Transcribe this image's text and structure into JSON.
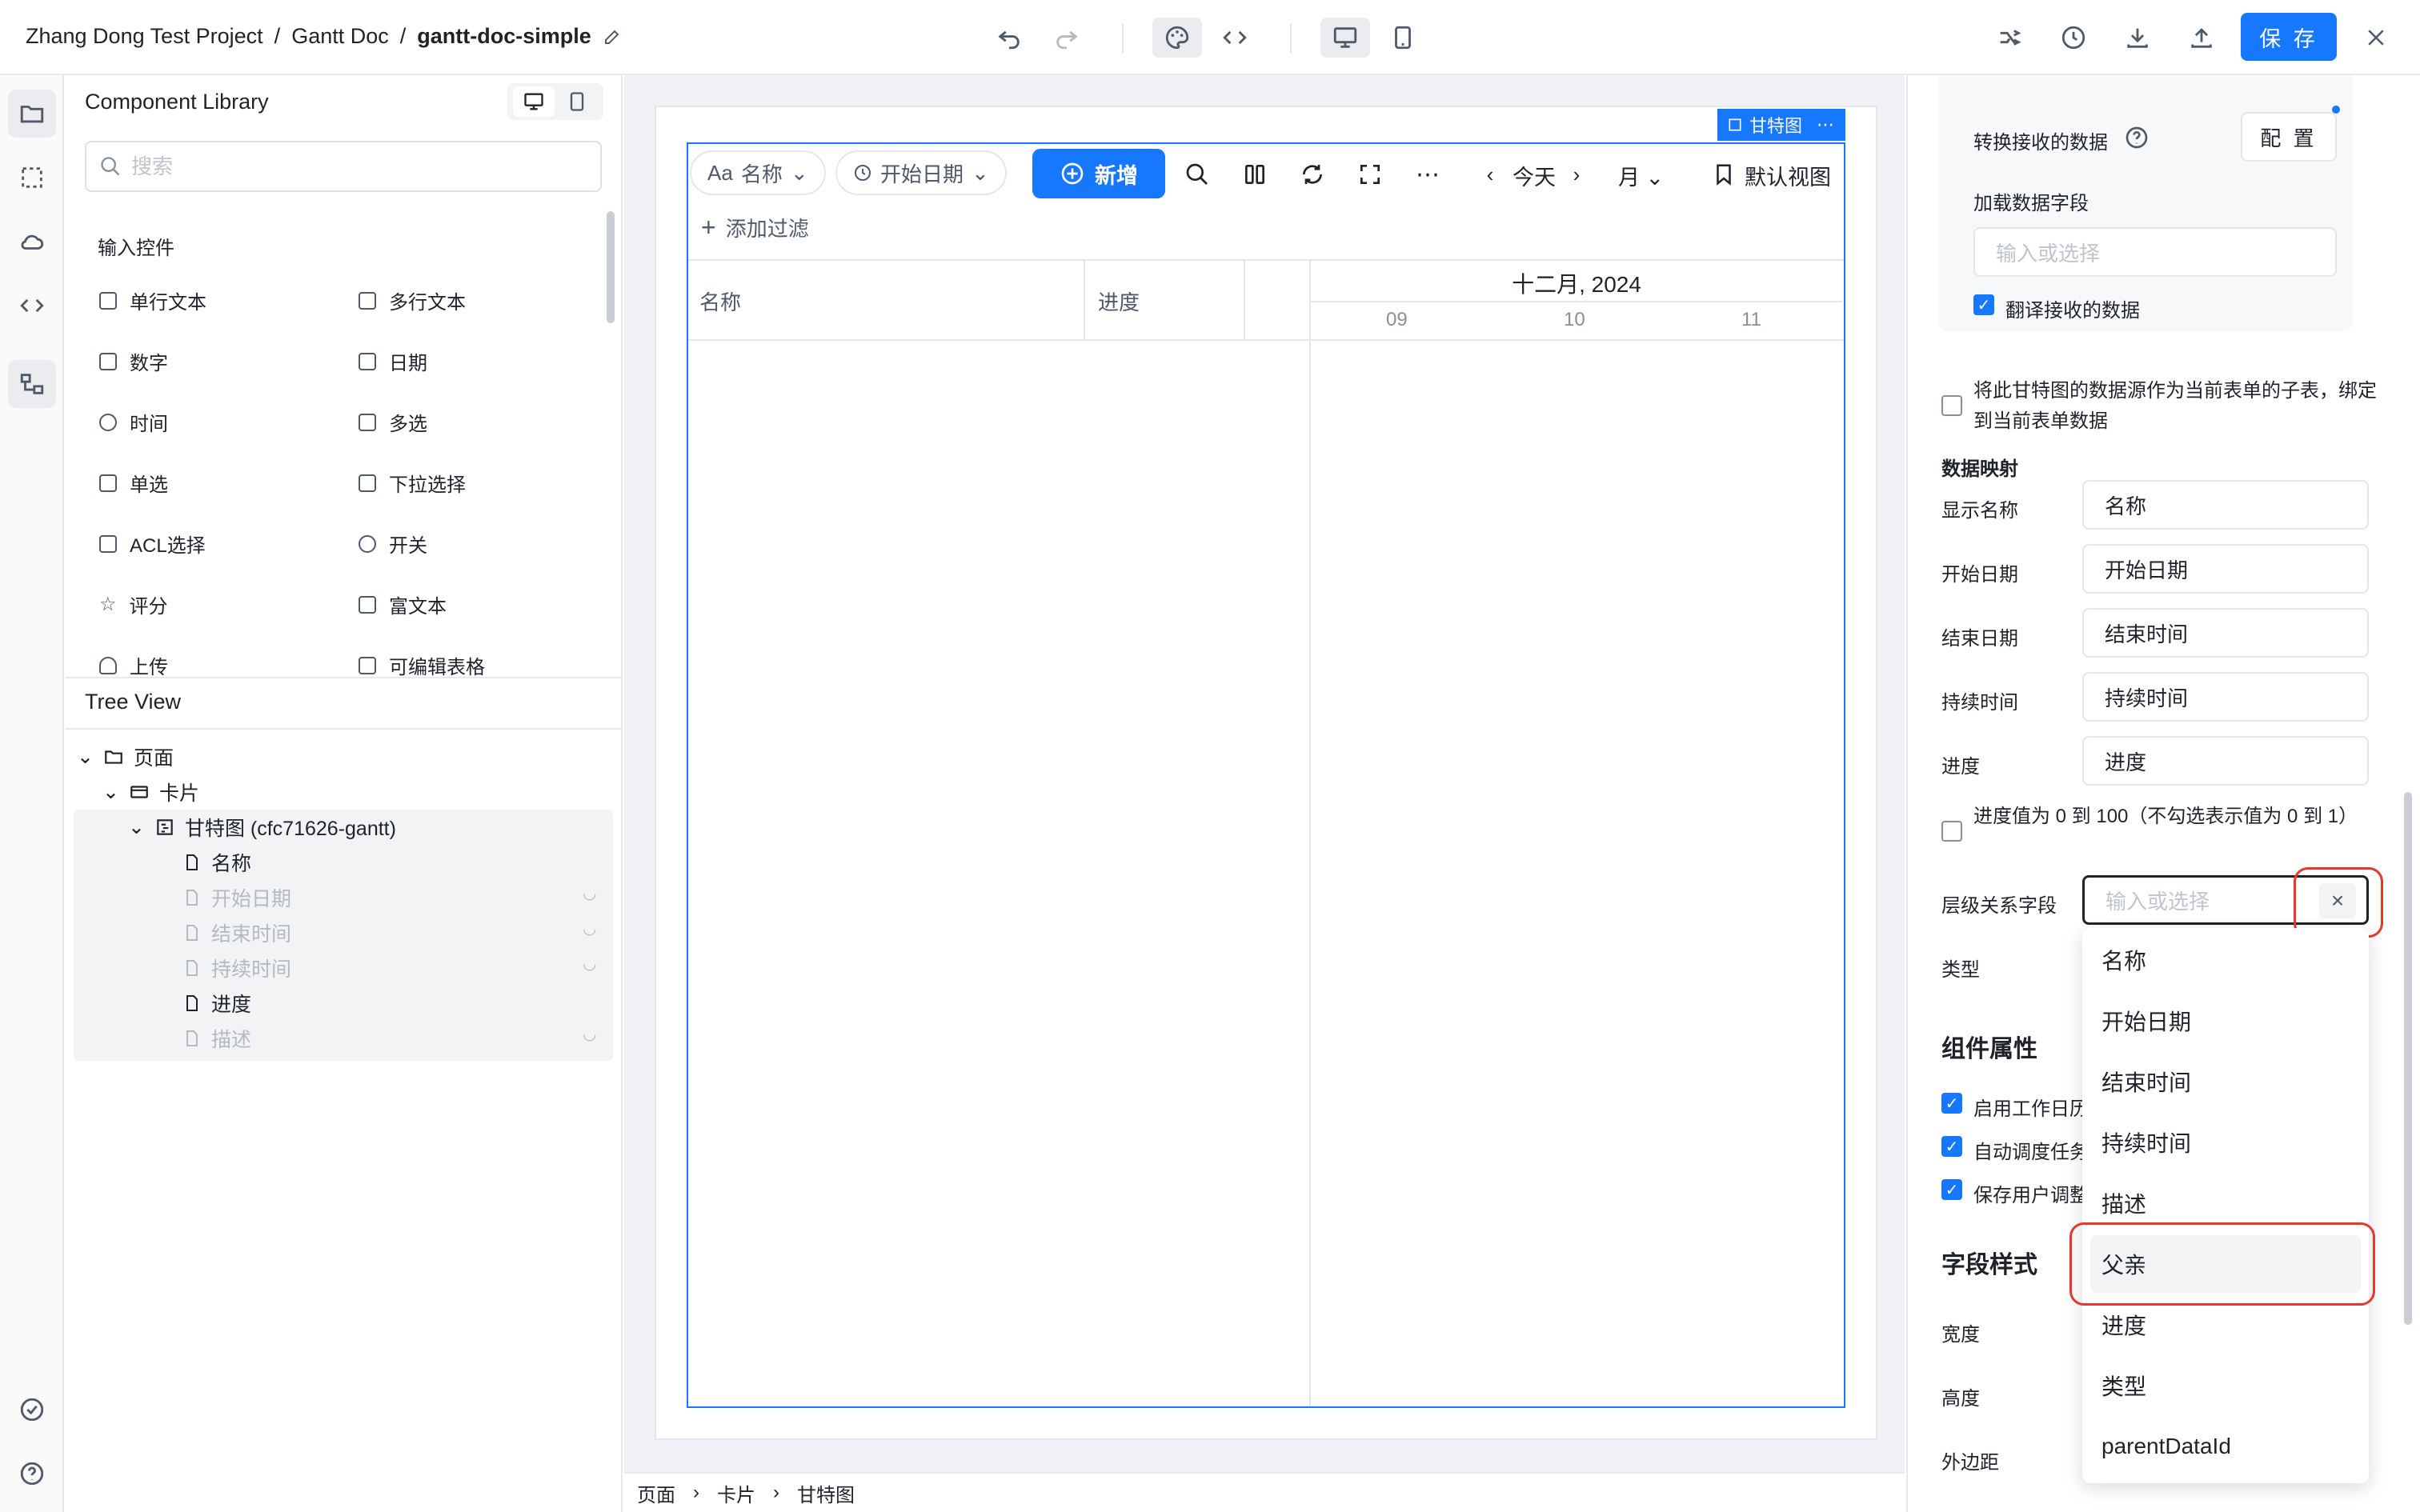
{
  "header": {
    "project": "Zhang Dong Test Project",
    "doc": "Gantt Doc",
    "page": "gantt-doc-simple",
    "separator": "/",
    "save_label": "保 存"
  },
  "library": {
    "title": "Component Library",
    "search_placeholder": "搜索",
    "section": "输入控件",
    "components": [
      "单行文本",
      "多行文本",
      "数字",
      "日期",
      "时间",
      "多选",
      "单选",
      "下拉选择",
      "ACL选择",
      "开关",
      "评分",
      "富文本",
      "上传",
      "可编辑表格"
    ]
  },
  "tree": {
    "title": "Tree View",
    "nodes": [
      "页面",
      "卡片",
      "甘特图 (cfc71626-gantt)",
      "名称",
      "开始日期",
      "结束时间",
      "持续时间",
      "进度",
      "描述"
    ]
  },
  "gantt": {
    "tag": "甘特图",
    "pill_name": "名称",
    "pill_date": "开始日期",
    "new_label": "新增",
    "today": "今天",
    "view_mode": "月",
    "default_view": "默认视图",
    "add_filter": "添加过滤",
    "col_name": "名称",
    "col_progress": "进度",
    "month": "十二月, 2024",
    "days": [
      "09",
      "10",
      "11"
    ]
  },
  "statusbar": {
    "items": [
      "页面",
      "卡片",
      "甘特图"
    ]
  },
  "rpanel": {
    "transform_label": "转换接收的数据",
    "config_btn": "配 置",
    "load_field_label": "加载数据字段",
    "load_field_placeholder": "输入或选择",
    "translate_label": "翻译接收的数据",
    "subtable_label": "将此甘特图的数据源作为当前表单的子表，绑定到当前表单数据",
    "mapping_title": "数据映射",
    "mappings": [
      {
        "label": "显示名称",
        "value": "名称"
      },
      {
        "label": "开始日期",
        "value": "开始日期"
      },
      {
        "label": "结束日期",
        "value": "结束时间"
      },
      {
        "label": "持续时间",
        "value": "持续时间"
      },
      {
        "label": "进度",
        "value": "进度"
      }
    ],
    "progress_range_label": "进度值为 0 到 100（不勾选表示值为 0 到 1）",
    "hier_label": "层级关系字段",
    "hier_placeholder": "输入或选择",
    "type_label": "类型",
    "comp_props_title": "组件属性",
    "props": [
      "启用工作日历",
      "自动调度任务",
      "保存用户调整"
    ],
    "field_style_title": "字段样式",
    "width_label": "宽度",
    "height_label": "高度",
    "margin_label": "外边距",
    "dropdown_options": [
      "名称",
      "开始日期",
      "结束时间",
      "持续时间",
      "描述",
      "父亲",
      "进度",
      "类型",
      "parentDataId"
    ],
    "highlighted_option": "父亲"
  }
}
